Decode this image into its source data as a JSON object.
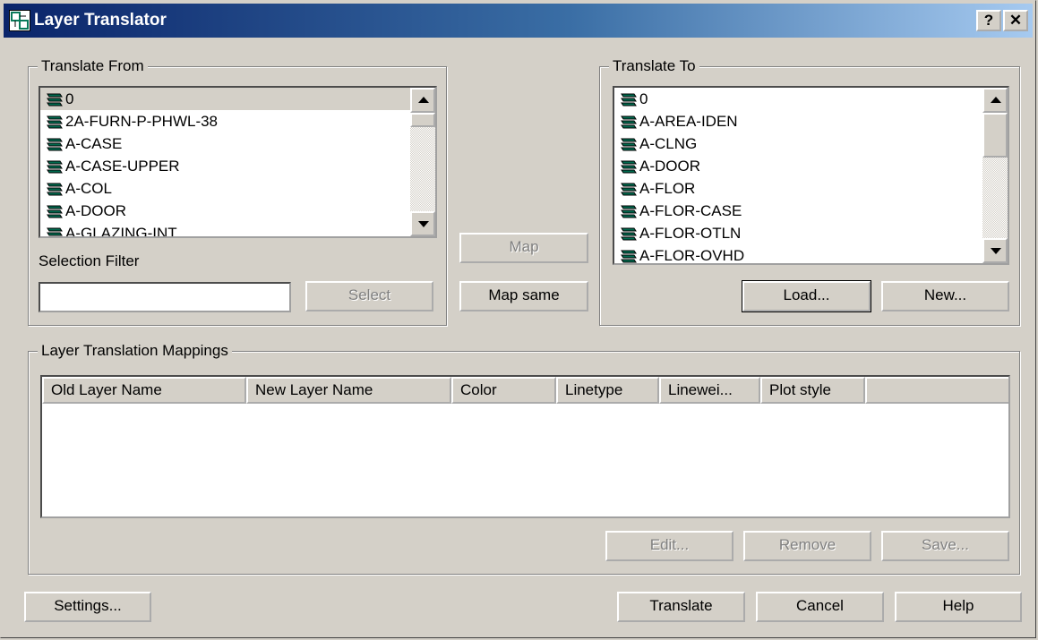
{
  "window": {
    "title": "Layer Translator",
    "help_glyph": "?",
    "close_glyph": "✕"
  },
  "translate_from": {
    "legend": "Translate From",
    "items": [
      {
        "label": "0",
        "selected": true
      },
      {
        "label": "2A-FURN-P-PHWL-38"
      },
      {
        "label": "A-CASE"
      },
      {
        "label": "A-CASE-UPPER"
      },
      {
        "label": "A-COL"
      },
      {
        "label": "A-DOOR"
      },
      {
        "label": "A-GLAZING-INT"
      }
    ],
    "selection_filter_label": "Selection Filter",
    "selection_filter_value": "",
    "select_button": "Select"
  },
  "middle": {
    "map_button": "Map",
    "map_same_button": "Map same"
  },
  "translate_to": {
    "legend": "Translate To",
    "items": [
      {
        "label": "0"
      },
      {
        "label": "A-AREA-IDEN"
      },
      {
        "label": "A-CLNG"
      },
      {
        "label": "A-DOOR"
      },
      {
        "label": "A-FLOR"
      },
      {
        "label": "A-FLOR-CASE"
      },
      {
        "label": "A-FLOR-OTLN"
      },
      {
        "label": "A-FLOR-OVHD"
      }
    ],
    "load_button": "Load...",
    "new_button": "New..."
  },
  "mappings": {
    "legend": "Layer Translation Mappings",
    "columns": [
      "Old Layer Name",
      "New Layer Name",
      "Color",
      "Linetype",
      "Linewei...",
      "Plot style"
    ],
    "rows": [],
    "edit_button": "Edit...",
    "remove_button": "Remove",
    "save_button": "Save..."
  },
  "footer": {
    "settings_button": "Settings...",
    "translate_button": "Translate",
    "cancel_button": "Cancel",
    "help_button": "Help"
  },
  "colors": {
    "title_gradient_start": "#0a246a",
    "title_gradient_end": "#a6caf0",
    "layer_icon": "#006b4f",
    "dialog_face": "#d4d0c8"
  }
}
